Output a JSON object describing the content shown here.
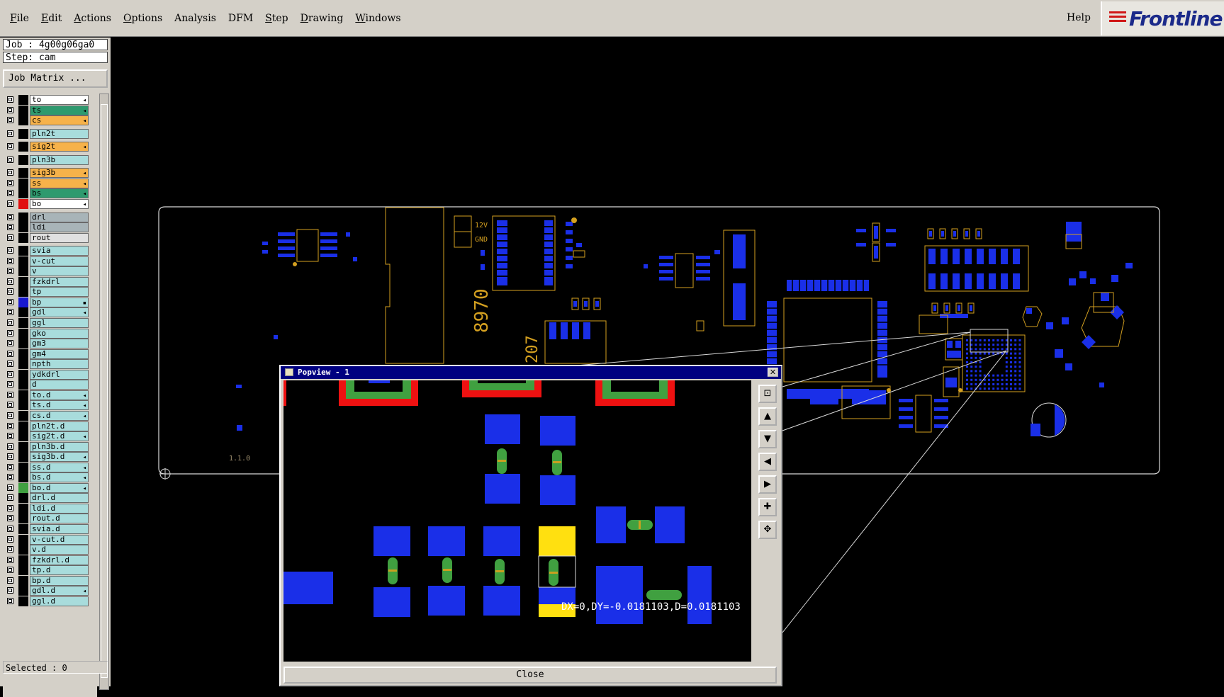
{
  "menu": {
    "items": [
      {
        "u": "F",
        "rest": "ile"
      },
      {
        "u": "E",
        "rest": "dit"
      },
      {
        "u": "A",
        "rest": "ctions"
      },
      {
        "u": "O",
        "rest": "ptions"
      },
      {
        "u": "",
        "rest": "Analysis"
      },
      {
        "u": "",
        "rest": "DFM"
      },
      {
        "u": "S",
        "rest": "tep"
      },
      {
        "u": "D",
        "rest": "rawing"
      },
      {
        "u": "W",
        "rest": "indows"
      }
    ],
    "help": "Help"
  },
  "logo": {
    "text": "Frontline"
  },
  "sidebar": {
    "job": "Job : 4g00g06ga0",
    "step": "Step: cam",
    "job_matrix": "Job Matrix ...",
    "selected": "Selected : 0",
    "layers": [
      {
        "name": "to",
        "color": "#ffffff",
        "sw": "#000000",
        "arrow": "◂"
      },
      {
        "name": "ts",
        "color": "#2e9a6e",
        "sw": "#000000",
        "arrow": "◂"
      },
      {
        "name": "cs",
        "color": "#f6b24a",
        "sw": "#000000",
        "arrow": "◂"
      },
      {
        "name": "pln2t",
        "color": "#a8dcdc",
        "sw": "#000000",
        "arrow": ""
      },
      {
        "name": "sig2t",
        "color": "#f6b24a",
        "sw": "#000000",
        "arrow": "◂"
      },
      {
        "name": "pln3b",
        "color": "#a8dcdc",
        "sw": "#000000",
        "arrow": ""
      },
      {
        "name": "sig3b",
        "color": "#f6b24a",
        "sw": "#000000",
        "arrow": "◂"
      },
      {
        "name": "ss",
        "color": "#f6b24a",
        "sw": "#000000",
        "arrow": "◂"
      },
      {
        "name": "bs",
        "color": "#2e9a6e",
        "sw": "#000000",
        "arrow": "◂"
      },
      {
        "name": "bo",
        "color": "#ffffff",
        "sw": "#e01010",
        "arrow": "◂"
      },
      {
        "name": "drl",
        "color": "#a8b4b8",
        "sw": "#000000",
        "arrow": ""
      },
      {
        "name": "ldi",
        "color": "#a8b4b8",
        "sw": "#000000",
        "arrow": ""
      },
      {
        "name": "rout",
        "color": "#e0e0e0",
        "sw": "#000000",
        "arrow": ""
      },
      {
        "name": "svia",
        "color": "#a8dcdc",
        "sw": "#000000",
        "arrow": ""
      },
      {
        "name": "v-cut",
        "color": "#a8dcdc",
        "sw": "#000000",
        "arrow": ""
      },
      {
        "name": "v",
        "color": "#a8dcdc",
        "sw": "#000000",
        "arrow": ""
      },
      {
        "name": "fzkdrl",
        "color": "#a8dcdc",
        "sw": "#000000",
        "arrow": ""
      },
      {
        "name": "tp",
        "color": "#a8dcdc",
        "sw": "#000000",
        "arrow": ""
      },
      {
        "name": "bp",
        "color": "#a8dcdc",
        "sw": "#1818d0",
        "arrow": "▪"
      },
      {
        "name": "gdl",
        "color": "#a8dcdc",
        "sw": "#000000",
        "arrow": "◂"
      },
      {
        "name": "ggl",
        "color": "#a8dcdc",
        "sw": "#000000",
        "arrow": ""
      },
      {
        "name": "gko",
        "color": "#a8dcdc",
        "sw": "#000000",
        "arrow": ""
      },
      {
        "name": "gm3",
        "color": "#a8dcdc",
        "sw": "#000000",
        "arrow": ""
      },
      {
        "name": "gm4",
        "color": "#a8dcdc",
        "sw": "#000000",
        "arrow": ""
      },
      {
        "name": "npth",
        "color": "#a8dcdc",
        "sw": "#000000",
        "arrow": ""
      },
      {
        "name": "ydkdrl",
        "color": "#a8dcdc",
        "sw": "#000000",
        "arrow": ""
      },
      {
        "name": "d",
        "color": "#a8dcdc",
        "sw": "#000000",
        "arrow": ""
      },
      {
        "name": "to.d",
        "color": "#a8dcdc",
        "sw": "#000000",
        "arrow": "◂"
      },
      {
        "name": "ts.d",
        "color": "#a8dcdc",
        "sw": "#000000",
        "arrow": "◂"
      },
      {
        "name": "cs.d",
        "color": "#a8dcdc",
        "sw": "#000000",
        "arrow": "◂"
      },
      {
        "name": "pln2t.d",
        "color": "#a8dcdc",
        "sw": "#000000",
        "arrow": ""
      },
      {
        "name": "sig2t.d",
        "color": "#a8dcdc",
        "sw": "#000000",
        "arrow": "◂"
      },
      {
        "name": "pln3b.d",
        "color": "#a8dcdc",
        "sw": "#000000",
        "arrow": ""
      },
      {
        "name": "sig3b.d",
        "color": "#a8dcdc",
        "sw": "#000000",
        "arrow": "◂"
      },
      {
        "name": "ss.d",
        "color": "#a8dcdc",
        "sw": "#000000",
        "arrow": "◂"
      },
      {
        "name": "bs.d",
        "color": "#a8dcdc",
        "sw": "#000000",
        "arrow": "◂"
      },
      {
        "name": "bo.d",
        "color": "#a8dcdc",
        "sw": "#40a040",
        "arrow": "◂"
      },
      {
        "name": "drl.d",
        "color": "#a8dcdc",
        "sw": "#000000",
        "arrow": ""
      },
      {
        "name": "ldi.d",
        "color": "#a8dcdc",
        "sw": "#000000",
        "arrow": ""
      },
      {
        "name": "rout.d",
        "color": "#a8dcdc",
        "sw": "#000000",
        "arrow": ""
      },
      {
        "name": "svia.d",
        "color": "#a8dcdc",
        "sw": "#000000",
        "arrow": ""
      },
      {
        "name": "v-cut.d",
        "color": "#a8dcdc",
        "sw": "#000000",
        "arrow": ""
      },
      {
        "name": "v.d",
        "color": "#a8dcdc",
        "sw": "#000000",
        "arrow": ""
      },
      {
        "name": "fzkdrl.d",
        "color": "#a8dcdc",
        "sw": "#000000",
        "arrow": ""
      },
      {
        "name": "tp.d",
        "color": "#a8dcdc",
        "sw": "#000000",
        "arrow": ""
      },
      {
        "name": "bp.d",
        "color": "#a8dcdc",
        "sw": "#000000",
        "arrow": ""
      },
      {
        "name": "gdl.d",
        "color": "#a8dcdc",
        "sw": "#000000",
        "arrow": "◂"
      },
      {
        "name": "ggl.d",
        "color": "#a8dcdc",
        "sw": "#000000",
        "arrow": ""
      }
    ]
  },
  "board": {
    "silkscreen": [
      "8970",
      "12V",
      "GND",
      "207",
      "1.1.0"
    ]
  },
  "popview": {
    "title": "Popview - 1",
    "close_label": "Close",
    "measurement": "DX=0,DY=-0.0181103,D=0.0181103",
    "tools": [
      "zoom-fit",
      "pan-up",
      "pan-down",
      "pan-left",
      "pan-right",
      "zoom-in",
      "zoom-out"
    ]
  }
}
